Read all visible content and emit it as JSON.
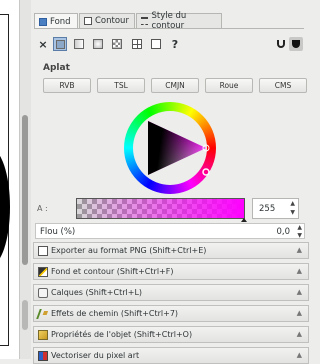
{
  "tabs": [
    {
      "label": "Fond",
      "icon": "fill-icon",
      "active": true
    },
    {
      "label": "Contour",
      "icon": "stroke-paint-icon",
      "active": false
    },
    {
      "label": "Style du contour",
      "icon": "stroke-style-icon",
      "active": false
    }
  ],
  "fill_modes": [
    "no-paint-icon",
    "flat-color-icon",
    "linear-gradient-icon",
    "radial-gradient-icon",
    "pattern-icon",
    "swatch-icon",
    "unset-icon",
    "evenodd-icon",
    "nonzero-icon"
  ],
  "fill_unset_label": "?",
  "section_title": "Aplat",
  "color_modes": [
    "RVB",
    "TSL",
    "CMJN",
    "Roue",
    "CMS"
  ],
  "active_color_mode": "Roue",
  "alpha": {
    "label": "A :",
    "value": "255",
    "fraction": 1.0
  },
  "blur": {
    "label": "Flou (%)",
    "value": "0,0"
  },
  "colors": {
    "current": "#ff00ff"
  },
  "docks": [
    {
      "label": "Exporter au format PNG (Shift+Ctrl+E)",
      "icon": "export-png-icon"
    },
    {
      "label": "Fond et contour (Shift+Ctrl+F)",
      "icon": "fill-stroke-icon"
    },
    {
      "label": "Calques (Shift+Ctrl+L)",
      "icon": "layers-icon"
    },
    {
      "label": "Effets de chemin (Shift+Ctrl+7)",
      "icon": "path-effects-icon"
    },
    {
      "label": "Propriétés de l'objet (Shift+Ctrl+O)",
      "icon": "object-properties-icon"
    },
    {
      "label": "Vectoriser du pixel art",
      "icon": "trace-pixel-art-icon"
    }
  ]
}
